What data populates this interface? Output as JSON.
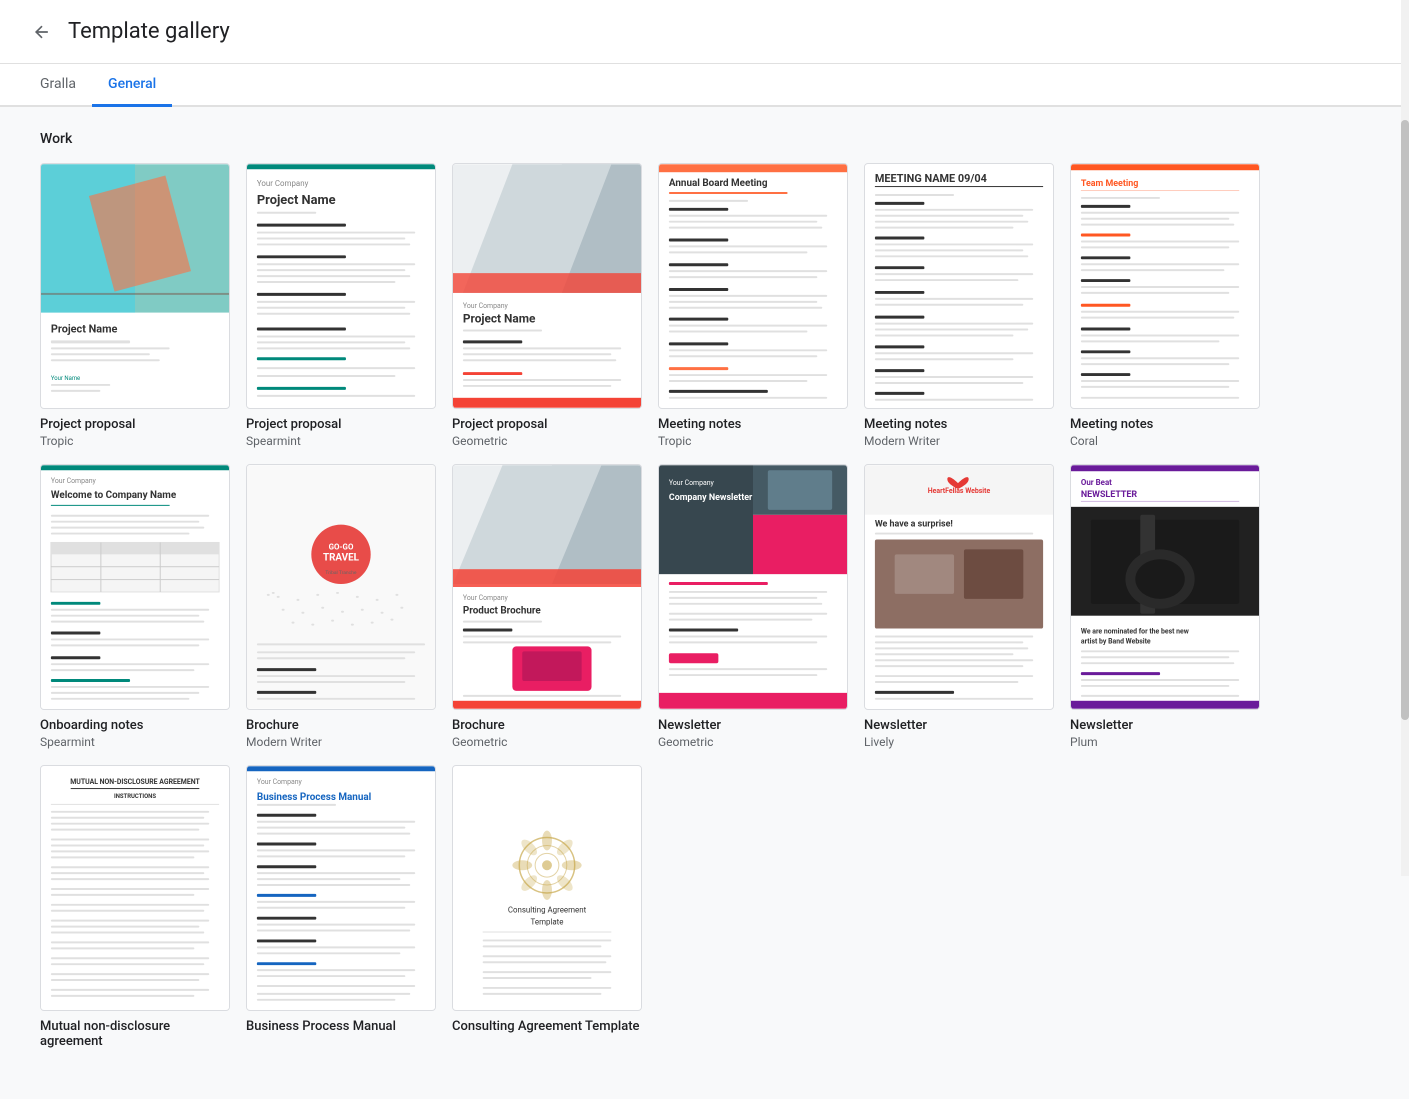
{
  "header": {
    "back_label": "←",
    "title": "Template gallery"
  },
  "tabs": [
    {
      "id": "gralla",
      "label": "Gralla",
      "active": false
    },
    {
      "id": "general",
      "label": "General",
      "active": true
    }
  ],
  "sections": [
    {
      "id": "work",
      "title": "Work",
      "templates": [
        {
          "id": "pp-tropic",
          "name": "Project proposal",
          "sub": "Tropic",
          "thumb_type": "pp-tropic"
        },
        {
          "id": "pp-spearmint",
          "name": "Project proposal",
          "sub": "Spearmint",
          "thumb_type": "pp-spearmint"
        },
        {
          "id": "pp-geometric",
          "name": "Project proposal",
          "sub": "Geometric",
          "thumb_type": "pp-geometric"
        },
        {
          "id": "mn-tropic",
          "name": "Meeting notes",
          "sub": "Tropic",
          "thumb_type": "mn-tropic"
        },
        {
          "id": "mn-modern",
          "name": "Meeting notes",
          "sub": "Modern Writer",
          "thumb_type": "mn-modern"
        },
        {
          "id": "mn-coral",
          "name": "Meeting notes",
          "sub": "Coral",
          "thumb_type": "mn-coral"
        },
        {
          "id": "on-spearmint",
          "name": "Onboarding notes",
          "sub": "Spearmint",
          "thumb_type": "on-spearmint"
        },
        {
          "id": "br-mw",
          "name": "Brochure",
          "sub": "Modern Writer",
          "thumb_type": "br-mw"
        },
        {
          "id": "br-geo",
          "name": "Brochure",
          "sub": "Geometric",
          "thumb_type": "br-geo"
        },
        {
          "id": "nl-geo",
          "name": "Newsletter",
          "sub": "Geometric",
          "thumb_type": "nl-geo"
        },
        {
          "id": "nl-lively",
          "name": "Newsletter",
          "sub": "Lively",
          "thumb_type": "nl-lively"
        },
        {
          "id": "nl-plum",
          "name": "Newsletter",
          "sub": "Plum",
          "thumb_type": "nl-plum"
        },
        {
          "id": "nda",
          "name": "Mutual non-disclosure agreement",
          "sub": "",
          "thumb_type": "nda"
        },
        {
          "id": "bpm",
          "name": "Business Process Manual",
          "sub": "",
          "thumb_type": "bpm"
        },
        {
          "id": "consulting",
          "name": "Consulting Agreement Template",
          "sub": "",
          "thumb_type": "consulting"
        }
      ]
    }
  ],
  "colors": {
    "accent": "#1a73e8",
    "teal": "#00897b",
    "coral": "#ff5722",
    "orange": "#ff7043",
    "plum": "#6a1b9a",
    "pink": "#e91e63",
    "gold": "#c8a84b"
  }
}
